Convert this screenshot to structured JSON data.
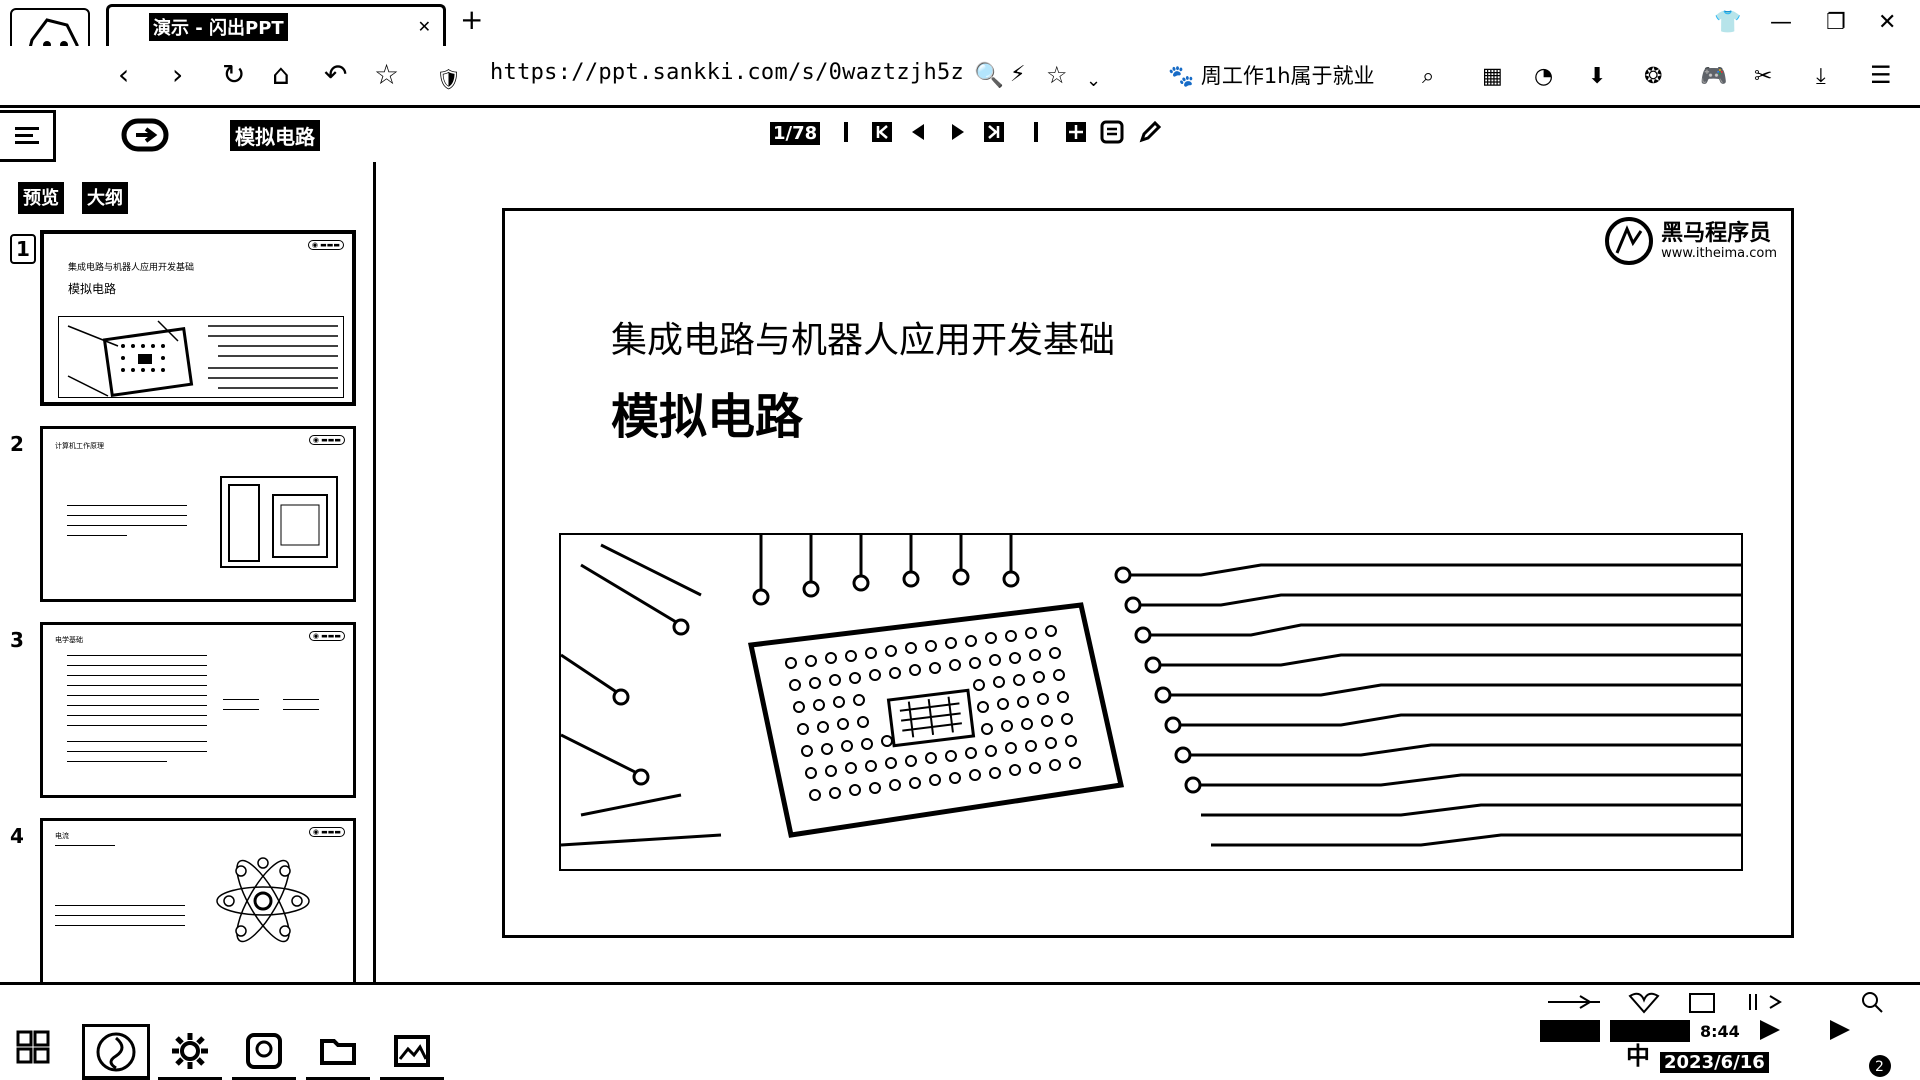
{
  "browser": {
    "tab_title": "演示 - 闪出PPT",
    "new_tab": "+",
    "url": "https://ppt.sankki.com/s/0waztzjh5z",
    "bookmark": "周工作1h属于就业"
  },
  "toolbar": {
    "doc_title": "模拟电路",
    "page_indicator": "1/78"
  },
  "sidebar": {
    "tabs": [
      "预览",
      "大纲"
    ],
    "thumbnails": [
      {
        "num": "1",
        "subtitle": "集成电路与机器人应用开发基础",
        "title": "模拟电路"
      },
      {
        "num": "2",
        "subtitle": "计算机工作原理",
        "title": ""
      },
      {
        "num": "3",
        "subtitle": "电学基础",
        "title": ""
      },
      {
        "num": "4",
        "subtitle": "电流",
        "title": ""
      }
    ]
  },
  "slide": {
    "brand_name": "黑马程序员",
    "brand_url": "www.itheima.com",
    "subtitle": "集成电路与机器人应用开发基础",
    "title": "模拟电路"
  },
  "taskbar": {
    "ime": "中",
    "time": "8:44",
    "date": "2023/6/16"
  }
}
